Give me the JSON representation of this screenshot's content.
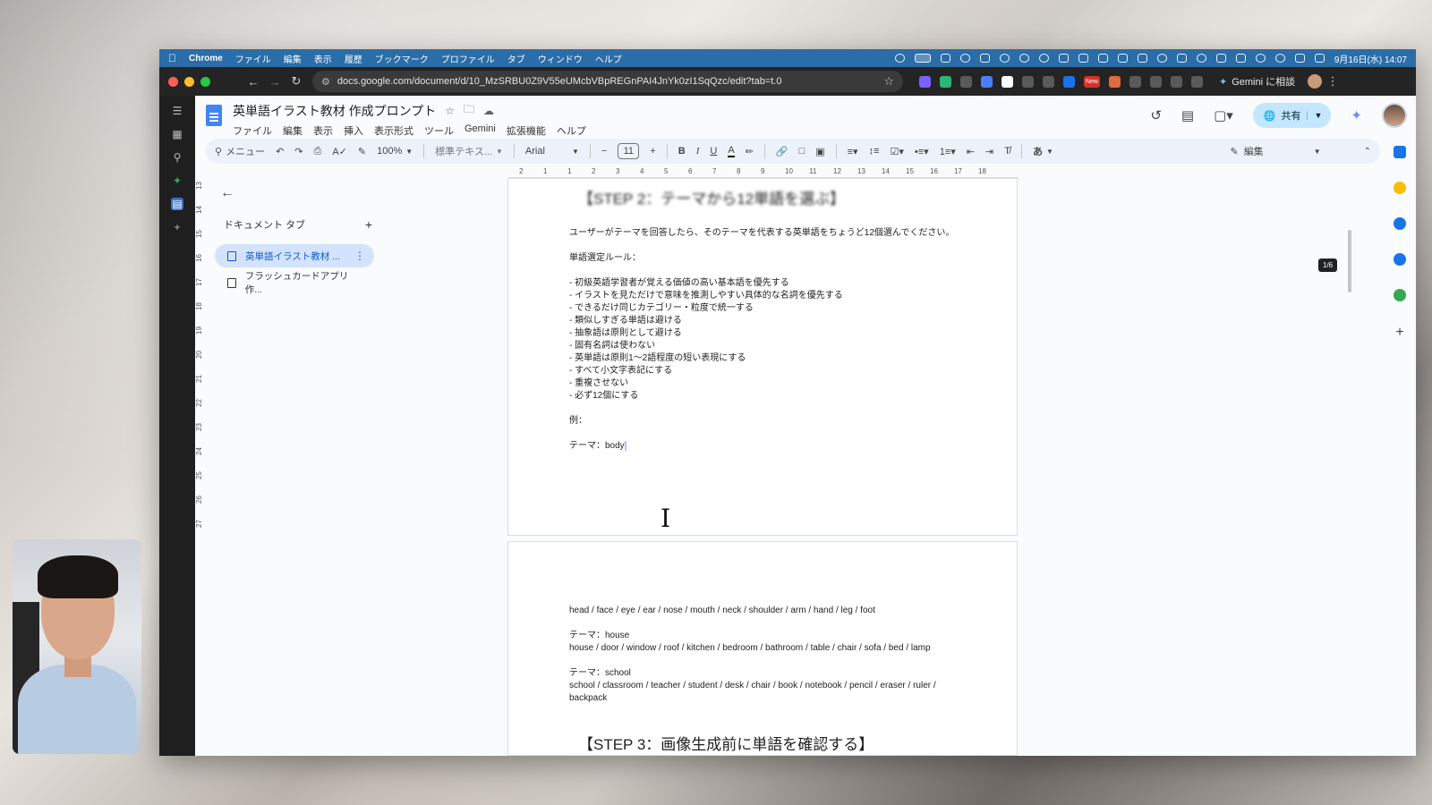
{
  "mac_menubar": {
    "app": "Chrome",
    "items": [
      "ファイル",
      "編集",
      "表示",
      "履歴",
      "ブックマーク",
      "プロファイル",
      "タブ",
      "ウィンドウ",
      "ヘルプ"
    ],
    "clock": "9月16日(水) 14:07"
  },
  "browser": {
    "url": "docs.google.com/document/d/10_MzSRBU0Z9V55eUMcbVBpREGnPAI4JnYk0zI1SqQzc/edit?tab=t.0",
    "gemini_label": "Gemini に相談",
    "new_badge": "New"
  },
  "doc": {
    "title": "英単語イラスト教材 作成プロンプト",
    "menus": [
      "ファイル",
      "編集",
      "表示",
      "挿入",
      "表示形式",
      "ツール",
      "Gemini",
      "拡張機能",
      "ヘルプ"
    ],
    "share_label": "共有"
  },
  "toolbar": {
    "search_label": "メニュー",
    "zoom": "100%",
    "style": "標準テキス...",
    "font": "Arial",
    "font_size": "11",
    "input_mode": "あ",
    "edit_mode": "編集"
  },
  "ruler": {
    "h_ticks": [
      "2",
      "1",
      "1",
      "2",
      "3",
      "4",
      "5",
      "6",
      "7",
      "8",
      "9",
      "10",
      "11",
      "12",
      "13",
      "14",
      "15",
      "16",
      "17",
      "18"
    ],
    "v_ticks": [
      "13",
      "14",
      "15",
      "16",
      "17",
      "18",
      "19",
      "20",
      "21",
      "22",
      "23",
      "24",
      "25",
      "26",
      "27"
    ]
  },
  "tabs_panel": {
    "header": "ドキュメント タブ",
    "tabs": [
      {
        "label": "英単語イラスト教材 ..."
      },
      {
        "label": "フラッシュカードアプリ 作..."
      }
    ]
  },
  "page1": {
    "heading_partial": "【STEP 2：テーマから12単語を選ぶ】",
    "intro": "ユーザーがテーマを回答したら、そのテーマを代表する英単語をちょうど12個選んでください。",
    "rules_title": "単語選定ルール：",
    "rules": [
      "- 初級英語学習者が覚える価値の高い基本語を優先する",
      "- イラストを見ただけで意味を推測しやすい具体的な名詞を優先する",
      "- できるだけ同じカテゴリー・粒度で統一する",
      "- 類似しすぎる単語は避ける",
      "- 抽象語は原則として避ける",
      "- 固有名詞は使わない",
      "- 英単語は原則1〜2語程度の短い表現にする",
      "- すべて小文字表記にする",
      "- 重複させない",
      "- 必ず12個にする"
    ],
    "example_label": "例：",
    "theme_prefix": "テーマ：body"
  },
  "page2": {
    "body_words": "head / face / eye / ear / nose / mouth / neck / shoulder / arm / hand / leg / foot",
    "theme_house": "テーマ：house",
    "house_words": "house / door / window / roof / kitchen / bedroom / bathroom / table / chair / sofa / bed / lamp",
    "theme_school": "テーマ：school",
    "school_words": "school / classroom / teacher / student / desk / chair / book / notebook / pencil / eraser / ruler / backpack",
    "next_heading": "【STEP 3：画像生成前に単語を確認する】"
  },
  "page_indicator": "1/6"
}
